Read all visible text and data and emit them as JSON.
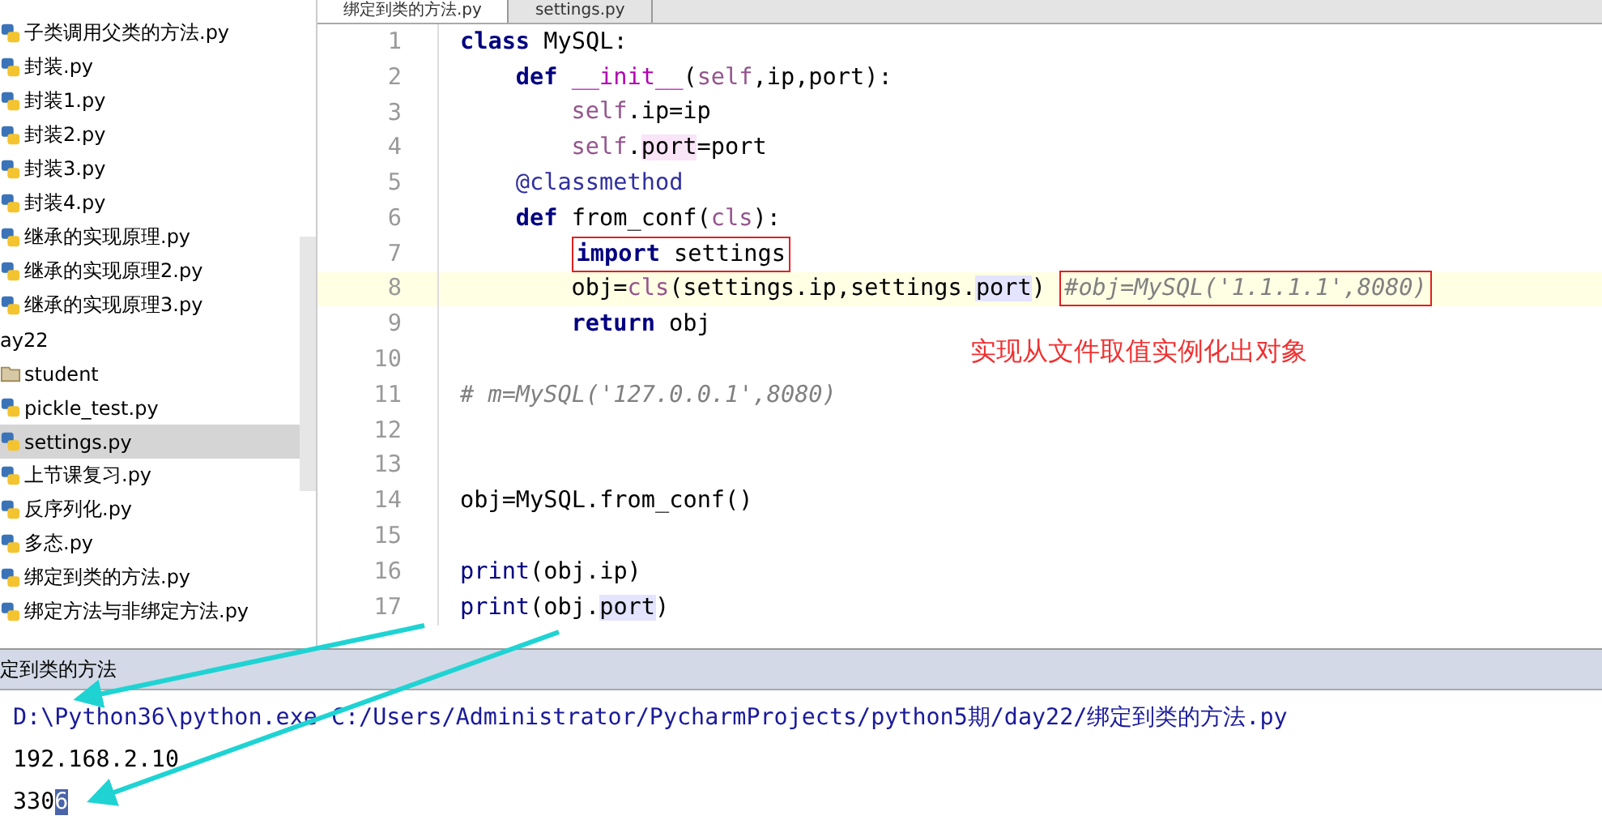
{
  "tabs": [
    {
      "label": "绑定到类的方法.py",
      "selected": true
    },
    {
      "label": "settings.py",
      "selected": false
    }
  ],
  "sidebar": {
    "items": [
      {
        "label": "子类调用父类的方法.py",
        "kind": "file",
        "selected": false
      },
      {
        "label": "封装.py",
        "kind": "file",
        "selected": false
      },
      {
        "label": "封装1.py",
        "kind": "file",
        "selected": false
      },
      {
        "label": "封装2.py",
        "kind": "file",
        "selected": false
      },
      {
        "label": "封装3.py",
        "kind": "file",
        "selected": false
      },
      {
        "label": "封装4.py",
        "kind": "file",
        "selected": false
      },
      {
        "label": "继承的实现原理.py",
        "kind": "file",
        "selected": false
      },
      {
        "label": "继承的实现原理2.py",
        "kind": "file",
        "selected": false
      },
      {
        "label": "继承的实现原理3.py",
        "kind": "file",
        "selected": false
      },
      {
        "label": "ay22",
        "kind": "dir",
        "selected": false
      },
      {
        "label": "student",
        "kind": "folder",
        "selected": false
      },
      {
        "label": "pickle_test.py",
        "kind": "file",
        "selected": false
      },
      {
        "label": "settings.py",
        "kind": "file",
        "selected": true
      },
      {
        "label": "上节课复习.py",
        "kind": "file",
        "selected": false
      },
      {
        "label": "反序列化.py",
        "kind": "file",
        "selected": false
      },
      {
        "label": "多态.py",
        "kind": "file",
        "selected": false
      },
      {
        "label": "绑定到类的方法.py",
        "kind": "file",
        "selected": false
      },
      {
        "label": "绑定方法与非绑定方法.py",
        "kind": "file",
        "selected": false
      }
    ]
  },
  "editor": {
    "lines": [
      {
        "number": "1",
        "current": false,
        "tokens": [
          {
            "text": "class",
            "kind": "keyword"
          },
          {
            "text": " MySQL:",
            "kind": "plain"
          }
        ],
        "children": [
          {
            "number": "2",
            "current": false,
            "tokens": [
              {
                "text": "def ",
                "kind": "keyword"
              },
              {
                "text": "__init__",
                "kind": "dunder"
              },
              {
                "text": "(",
                "kind": "plain"
              },
              {
                "text": "self",
                "kind": "self"
              },
              {
                "text": ",ip,port):",
                "kind": "plain"
              }
            ],
            "children": [
              {
                "number": "3",
                "current": false,
                "tokens": [
                  {
                    "text": "self",
                    "kind": "self"
                  },
                  {
                    "text": ".ip=ip",
                    "kind": "plain"
                  }
                ]
              },
              {
                "number": "4",
                "current": false,
                "tokens": [
                  {
                    "text": "self",
                    "kind": "self"
                  },
                  {
                    "text": ".",
                    "kind": "plain"
                  },
                  {
                    "text": "port",
                    "kind": "write"
                  },
                  {
                    "text": "=port",
                    "kind": "plain"
                  }
                ]
              }
            ]
          },
          {
            "number": "5",
            "current": false,
            "tokens": [
              {
                "text": "@classmethod",
                "kind": "decorator"
              }
            ]
          },
          {
            "number": "6",
            "current": false,
            "tokens": [
              {
                "text": "def",
                "kind": "keyword"
              },
              {
                "text": " from_conf(",
                "kind": "plain"
              },
              {
                "text": "cls",
                "kind": "self"
              },
              {
                "text": "):",
                "kind": "plain"
              }
            ],
            "children": [
              {
                "number": "7",
                "current": false,
                "tokens": [
                  {
                    "kind": "box",
                    "tokens": [
                      {
                        "text": "import",
                        "kind": "keyword"
                      },
                      {
                        "text": " settings",
                        "kind": "plain"
                      }
                    ]
                  }
                ]
              },
              {
                "number": "8",
                "current": true,
                "tokens": [
                  {
                    "text": "obj=",
                    "kind": "plain"
                  },
                  {
                    "text": "cls",
                    "kind": "self"
                  },
                  {
                    "text": "(settings.ip,settings.",
                    "kind": "plain"
                  },
                  {
                    "text": "port",
                    "kind": "read"
                  },
                  {
                    "text": ") ",
                    "kind": "plain"
                  },
                  {
                    "kind": "box",
                    "tokens": [
                      {
                        "text": "#obj=MySQL('1.1.1.1',8080)",
                        "kind": "comment"
                      }
                    ]
                  }
                ]
              },
              {
                "number": "9",
                "current": false,
                "tokens": [
                  {
                    "text": "return",
                    "kind": "keyword"
                  },
                  {
                    "text": " obj",
                    "kind": "plain"
                  }
                ]
              }
            ]
          }
        ]
      },
      {
        "number": "10",
        "current": false
      },
      {
        "number": "11",
        "current": false,
        "tokens": [
          {
            "text": "# m=MySQL('127.0.0.1',8080)",
            "kind": "comment"
          }
        ]
      },
      {
        "number": "12",
        "current": false
      },
      {
        "number": "13",
        "current": false
      },
      {
        "number": "14",
        "current": false,
        "tokens": [
          {
            "text": "obj=MySQL.from_conf()",
            "kind": "plain"
          }
        ]
      },
      {
        "number": "15",
        "current": false
      },
      {
        "number": "16",
        "current": false,
        "tokens": [
          {
            "text": "print",
            "kind": "builtin"
          },
          {
            "text": "(obj.ip)",
            "kind": "plain"
          }
        ]
      },
      {
        "number": "17",
        "current": false,
        "tokens": [
          {
            "text": "print",
            "kind": "builtin"
          },
          {
            "text": "(obj.",
            "kind": "plain"
          },
          {
            "text": "port",
            "kind": "read"
          },
          {
            "text": ")",
            "kind": "plain"
          }
        ]
      }
    ],
    "note": "实现从文件取值实例化出对象"
  },
  "console": {
    "title": "定到类的方法",
    "lines": [
      {
        "kind": "command",
        "segments": [
          {
            "text": "D:\\Python36\\python.exe C:/Users/Administrator/PycharmProjects/python5期/day22/绑定到类的方法.py",
            "selected": false
          }
        ]
      },
      {
        "kind": "output",
        "segments": [
          {
            "text": "192.168.2.10",
            "selected": false
          }
        ]
      },
      {
        "kind": "output",
        "segments": [
          {
            "text": "330",
            "selected": false
          },
          {
            "text": "6",
            "selected": true
          }
        ]
      }
    ]
  }
}
